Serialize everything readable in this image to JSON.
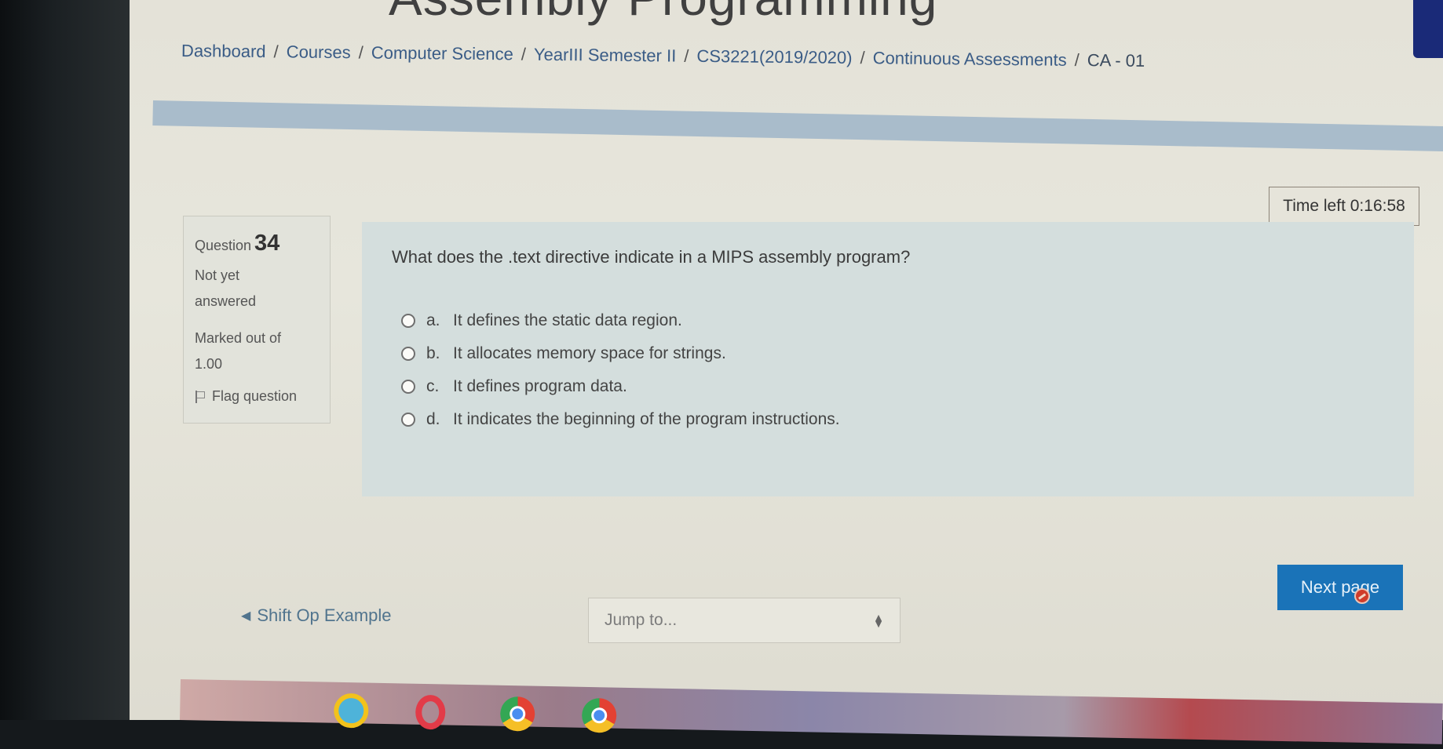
{
  "page": {
    "course_title": "Assembly Programming"
  },
  "breadcrumb": [
    {
      "label": "Dashboard"
    },
    {
      "label": "Courses"
    },
    {
      "label": "Computer Science"
    },
    {
      "label": "YearIII Semester II"
    },
    {
      "label": "CS3221(2019/2020)"
    },
    {
      "label": "Continuous Assessments"
    },
    {
      "label": "CA - 01"
    }
  ],
  "breadcrumb_separator": "/",
  "timer": {
    "label": "Time left",
    "value": "0:16:58"
  },
  "question_info": {
    "question_label": "Question",
    "question_number": "34",
    "state_line1": "Not yet",
    "state_line2": "answered",
    "marked_line1": "Marked out of",
    "marked_value": "1.00",
    "flag_label": "Flag question"
  },
  "question": {
    "text": "What does the .text directive indicate in a MIPS assembly program?",
    "answers": [
      {
        "letter": "a.",
        "text": "It defines the static data region."
      },
      {
        "letter": "b.",
        "text": "It allocates memory space for strings."
      },
      {
        "letter": "c.",
        "text": "It defines program data."
      },
      {
        "letter": "d.",
        "text": "It indicates the beginning of the program instructions."
      }
    ]
  },
  "navigation": {
    "next_label": "Next page",
    "prev_activity_label": "Shift Op Example",
    "jump_placeholder": "Jump to..."
  },
  "colors": {
    "accent": "#1a73b8",
    "link": "#3a5c86",
    "panel": "#d4dedd"
  }
}
